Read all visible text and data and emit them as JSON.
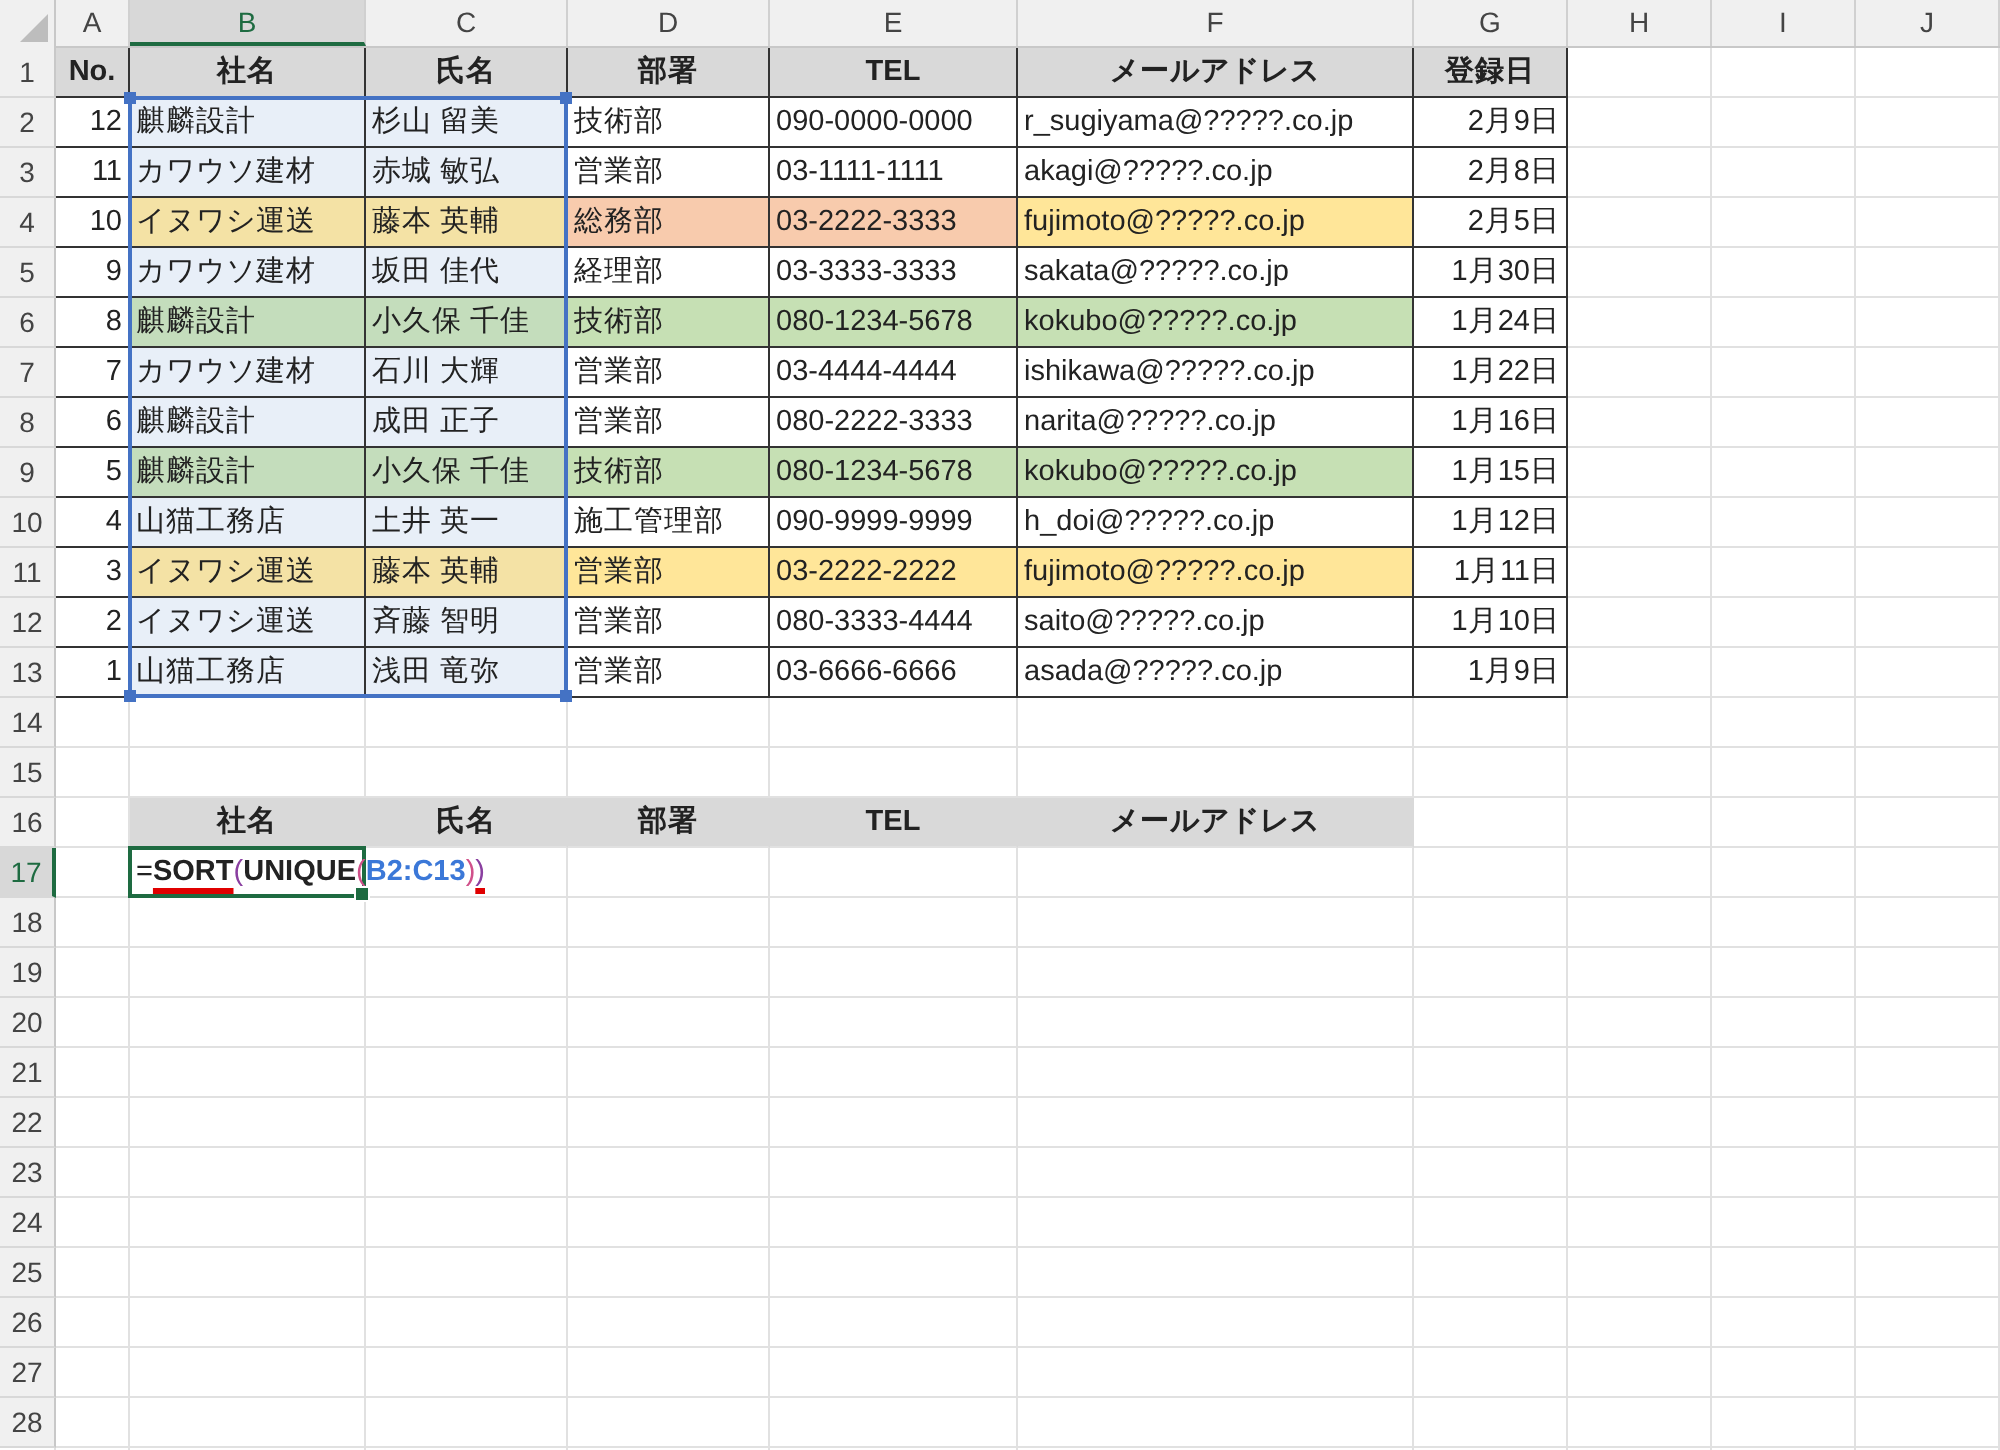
{
  "sheet": {
    "columns": [
      {
        "label": "A",
        "selected": false
      },
      {
        "label": "B",
        "selected": true
      },
      {
        "label": "C",
        "selected": false
      },
      {
        "label": "D",
        "selected": false
      },
      {
        "label": "E",
        "selected": false
      },
      {
        "label": "F",
        "selected": false
      },
      {
        "label": "G",
        "selected": false
      },
      {
        "label": "H",
        "selected": false
      },
      {
        "label": "I",
        "selected": false
      },
      {
        "label": "J",
        "selected": false
      }
    ],
    "row_numbers": [
      {
        "label": "1",
        "selected": false
      },
      {
        "label": "2",
        "selected": false
      },
      {
        "label": "3",
        "selected": false
      },
      {
        "label": "4",
        "selected": false
      },
      {
        "label": "5",
        "selected": false
      },
      {
        "label": "6",
        "selected": false
      },
      {
        "label": "7",
        "selected": false
      },
      {
        "label": "8",
        "selected": false
      },
      {
        "label": "9",
        "selected": false
      },
      {
        "label": "10",
        "selected": false
      },
      {
        "label": "11",
        "selected": false
      },
      {
        "label": "12",
        "selected": false
      },
      {
        "label": "13",
        "selected": false
      },
      {
        "label": "14",
        "selected": false
      },
      {
        "label": "15",
        "selected": false
      },
      {
        "label": "16",
        "selected": false
      },
      {
        "label": "17",
        "selected": true
      },
      {
        "label": "18",
        "selected": false
      },
      {
        "label": "19",
        "selected": false
      },
      {
        "label": "20",
        "selected": false
      },
      {
        "label": "21",
        "selected": false
      },
      {
        "label": "22",
        "selected": false
      },
      {
        "label": "23",
        "selected": false
      },
      {
        "label": "24",
        "selected": false
      },
      {
        "label": "25",
        "selected": false
      },
      {
        "label": "26",
        "selected": false
      },
      {
        "label": "27",
        "selected": false
      },
      {
        "label": "28",
        "selected": false
      }
    ]
  },
  "table": {
    "headers": [
      "No.",
      "社名",
      "氏名",
      "部署",
      "TEL",
      "メールアドレス",
      "登録日"
    ],
    "rows": [
      {
        "no": "12",
        "company": "麒麟設計",
        "name": "杉山 留美",
        "dept": "技術部",
        "tel": "090-0000-0000",
        "email": "r_sugiyama@?????.co.jp",
        "date": "2月9日"
      },
      {
        "no": "11",
        "company": "カワウソ建材",
        "name": "赤城 敏弘",
        "dept": "営業部",
        "tel": "03-1111-1111",
        "email": "akagi@?????.co.jp",
        "date": "2月8日"
      },
      {
        "no": "10",
        "company": "イヌワシ運送",
        "name": "藤本 英輔",
        "dept": "総務部",
        "tel": "03-2222-3333",
        "email": "fujimoto@?????.co.jp",
        "date": "2月5日",
        "color": "#ffe699",
        "mismatch": {
          "color": "#f8cbad"
        }
      },
      {
        "no": "9",
        "company": "カワウソ建材",
        "name": "坂田 佳代",
        "dept": "経理部",
        "tel": "03-3333-3333",
        "email": "sakata@?????.co.jp",
        "date": "1月30日"
      },
      {
        "no": "8",
        "company": "麒麟設計",
        "name": "小久保 千佳",
        "dept": "技術部",
        "tel": "080-1234-5678",
        "email": "kokubo@?????.co.jp",
        "date": "1月24日",
        "color": "#c6e0b4"
      },
      {
        "no": "7",
        "company": "カワウソ建材",
        "name": "石川 大輝",
        "dept": "営業部",
        "tel": "03-4444-4444",
        "email": "ishikawa@?????.co.jp",
        "date": "1月22日"
      },
      {
        "no": "6",
        "company": "麒麟設計",
        "name": "成田 正子",
        "dept": "営業部",
        "tel": "080-2222-3333",
        "email": "narita@?????.co.jp",
        "date": "1月16日"
      },
      {
        "no": "5",
        "company": "麒麟設計",
        "name": "小久保 千佳",
        "dept": "技術部",
        "tel": "080-1234-5678",
        "email": "kokubo@?????.co.jp",
        "date": "1月15日",
        "color": "#c6e0b4"
      },
      {
        "no": "4",
        "company": "山猫工務店",
        "name": "土井 英一",
        "dept": "施工管理部",
        "tel": "090-9999-9999",
        "email": "h_doi@?????.co.jp",
        "date": "1月12日"
      },
      {
        "no": "3",
        "company": "イヌワシ運送",
        "name": "藤本 英輔",
        "dept": "営業部",
        "tel": "03-2222-2222",
        "email": "fujimoto@?????.co.jp",
        "date": "1月11日",
        "color": "#ffe699"
      },
      {
        "no": "2",
        "company": "イヌワシ運送",
        "name": "斉藤 智明",
        "dept": "営業部",
        "tel": "080-3333-4444",
        "email": "saito@?????.co.jp",
        "date": "1月10日"
      },
      {
        "no": "1",
        "company": "山猫工務店",
        "name": "浅田 竜弥",
        "dept": "営業部",
        "tel": "03-6666-6666",
        "email": "asada@?????.co.jp",
        "date": "1月9日"
      }
    ]
  },
  "output": {
    "headers": [
      "社名",
      "氏名",
      "部署",
      "TEL",
      "メールアドレス"
    ],
    "formula": [
      {
        "text": "=",
        "kind": "plain",
        "flagged": false
      },
      {
        "text": "SORT",
        "kind": "function",
        "flagged": true
      },
      {
        "text": "(",
        "kind": "paren_outer",
        "flagged": false
      },
      {
        "text": "UNIQUE",
        "kind": "function",
        "flagged": false
      },
      {
        "text": "(",
        "kind": "paren_inner",
        "flagged": false
      },
      {
        "text": "B2:C13",
        "kind": "reference",
        "flagged": false
      },
      {
        "text": ")",
        "kind": "paren_inner",
        "flagged": false
      },
      {
        "text": ")",
        "kind": "paren_outer",
        "flagged": true
      }
    ]
  }
}
